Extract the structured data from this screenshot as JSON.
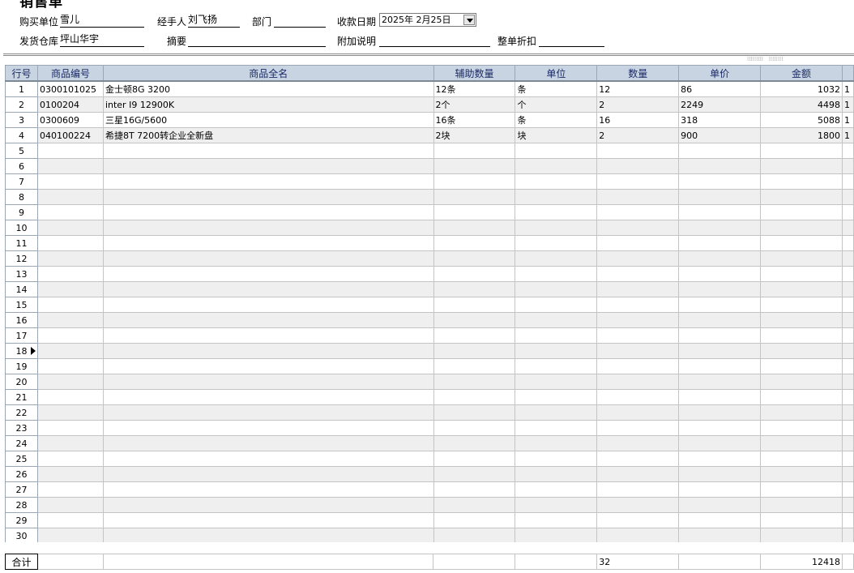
{
  "form": {
    "title": "销售单",
    "buyer_label": "购买单位",
    "buyer_value": "雪儿",
    "handler_label": "经手人",
    "handler_value": "刘飞扬",
    "dept_label": "部门",
    "dept_value": "",
    "date_label": "收款日期",
    "date_value": "2025年 2月25日",
    "warehouse_label": "发货仓库",
    "warehouse_value": "坪山华宇",
    "summary_label": "摘要",
    "summary_value": "",
    "note_label": "附加说明",
    "note_value": "",
    "discount_label": "整单折扣",
    "discount_value": ""
  },
  "grid": {
    "headers": [
      "行号",
      "商品编号",
      "商品全名",
      "辅助数量",
      "单位",
      "数量",
      "单价",
      "金额"
    ],
    "rows": [
      {
        "no": "1",
        "code": "0300101025",
        "name": "金士顿8G 3200",
        "aux": "12条",
        "unit": "条",
        "qty": "12",
        "price": "86",
        "amount": "1032",
        "extra": "1"
      },
      {
        "no": "2",
        "code": "0100204",
        "name": "inter I9 12900K",
        "aux": "2个",
        "unit": "个",
        "qty": "2",
        "price": "2249",
        "amount": "4498",
        "extra": "1"
      },
      {
        "no": "3",
        "code": "0300609",
        "name": "三星16G/5600",
        "aux": "16条",
        "unit": "条",
        "qty": "16",
        "price": "318",
        "amount": "5088",
        "extra": "1"
      },
      {
        "no": "4",
        "code": "040100224",
        "name": "希捷8T 7200转企业全新盘",
        "aux": "2块",
        "unit": "块",
        "qty": "2",
        "price": "900",
        "amount": "1800",
        "extra": "1"
      },
      {
        "no": "5"
      },
      {
        "no": "6"
      },
      {
        "no": "7"
      },
      {
        "no": "8"
      },
      {
        "no": "9"
      },
      {
        "no": "10"
      },
      {
        "no": "11"
      },
      {
        "no": "12"
      },
      {
        "no": "13"
      },
      {
        "no": "14"
      },
      {
        "no": "15"
      },
      {
        "no": "16"
      },
      {
        "no": "17"
      },
      {
        "no": "18",
        "current": true
      },
      {
        "no": "19"
      },
      {
        "no": "20"
      },
      {
        "no": "21"
      },
      {
        "no": "22"
      },
      {
        "no": "23"
      },
      {
        "no": "24"
      },
      {
        "no": "25"
      },
      {
        "no": "26"
      },
      {
        "no": "27"
      },
      {
        "no": "28"
      },
      {
        "no": "29"
      },
      {
        "no": "30"
      }
    ]
  },
  "totals": {
    "label": "合计",
    "qty": "32",
    "amount": "12418"
  }
}
